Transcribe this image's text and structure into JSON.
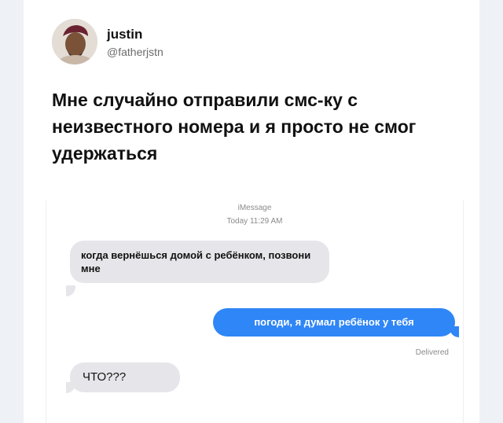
{
  "tweet": {
    "user_name": "justin",
    "user_handle": "@fatherjstn",
    "text": "Мне случайно отправили смс-ку с неизвестного номера и я просто не смог удержаться"
  },
  "imessage": {
    "service": "iMessage",
    "timestamp": "Today 11:29 AM",
    "messages": [
      {
        "direction": "incoming",
        "text": "когда вернёшься домой с ребёнком, позвони мне"
      },
      {
        "direction": "outgoing",
        "text": "погоди, я думал ребёнок у тебя"
      },
      {
        "direction": "incoming",
        "text": "ЧТО???"
      }
    ],
    "status": "Delivered"
  },
  "colors": {
    "outgoing_bubble": "#2f86f6",
    "incoming_bubble": "#e6e6ea",
    "page_background": "#eef1f5"
  },
  "icons": {
    "avatar": "user-avatar-photo"
  }
}
